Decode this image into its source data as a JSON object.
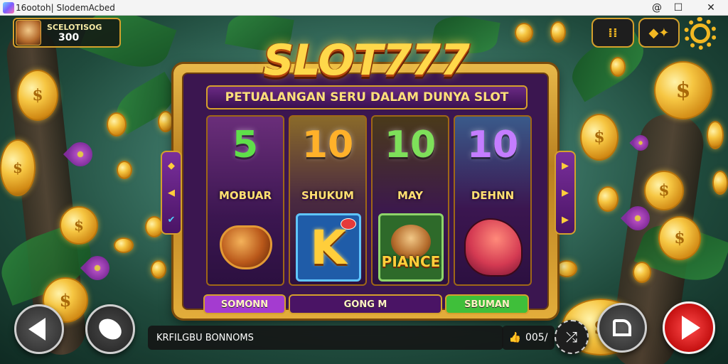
{
  "window": {
    "title": "16ootoh| SIodemAcbed",
    "controls": [
      "@",
      "☐",
      "✕"
    ]
  },
  "player": {
    "name": "SCELOTISOG",
    "score": "300"
  },
  "top_buttons": {
    "menu_glyph": "⁞⁞",
    "diamond_glyph": "◆✦",
    "settings_icon": "gear-icon"
  },
  "game": {
    "logo": "SLOT777",
    "subtitle": "PETUALANGAN SERU DALAM DUNYA SLOT",
    "reels": [
      {
        "number": "5",
        "label": "MOBUAR",
        "number_color": "#5fe04a",
        "symbol": "golden-pot"
      },
      {
        "number": "10",
        "label": "SHUKUM",
        "number_color": "#ffb12a",
        "symbol": "K",
        "symbol_text": "K"
      },
      {
        "number": "10",
        "label": "MAY",
        "number_color": "#7ee05a",
        "symbol": "lion",
        "symbol_text": "PIANCE"
      },
      {
        "number": "10",
        "label": "DEHNN",
        "number_color": "#c47dff",
        "symbol": "red-beast"
      }
    ],
    "left_tab_glyphs": [
      "◆",
      "◀",
      "✔"
    ],
    "right_tab_glyphs": [
      "▶",
      "▶",
      "▶"
    ],
    "buttons": {
      "left": "SOMONN",
      "center": "GONG M",
      "right": "SBUMAN"
    },
    "colors": {
      "left_button": "#a43bd0",
      "center_button": "#4a1465",
      "right_button": "#3fbf3a"
    }
  },
  "bottom": {
    "info_text": "KRFILGBU BONNOMS",
    "counter": "005/",
    "counter_icon": "thumbs-up-icon"
  }
}
